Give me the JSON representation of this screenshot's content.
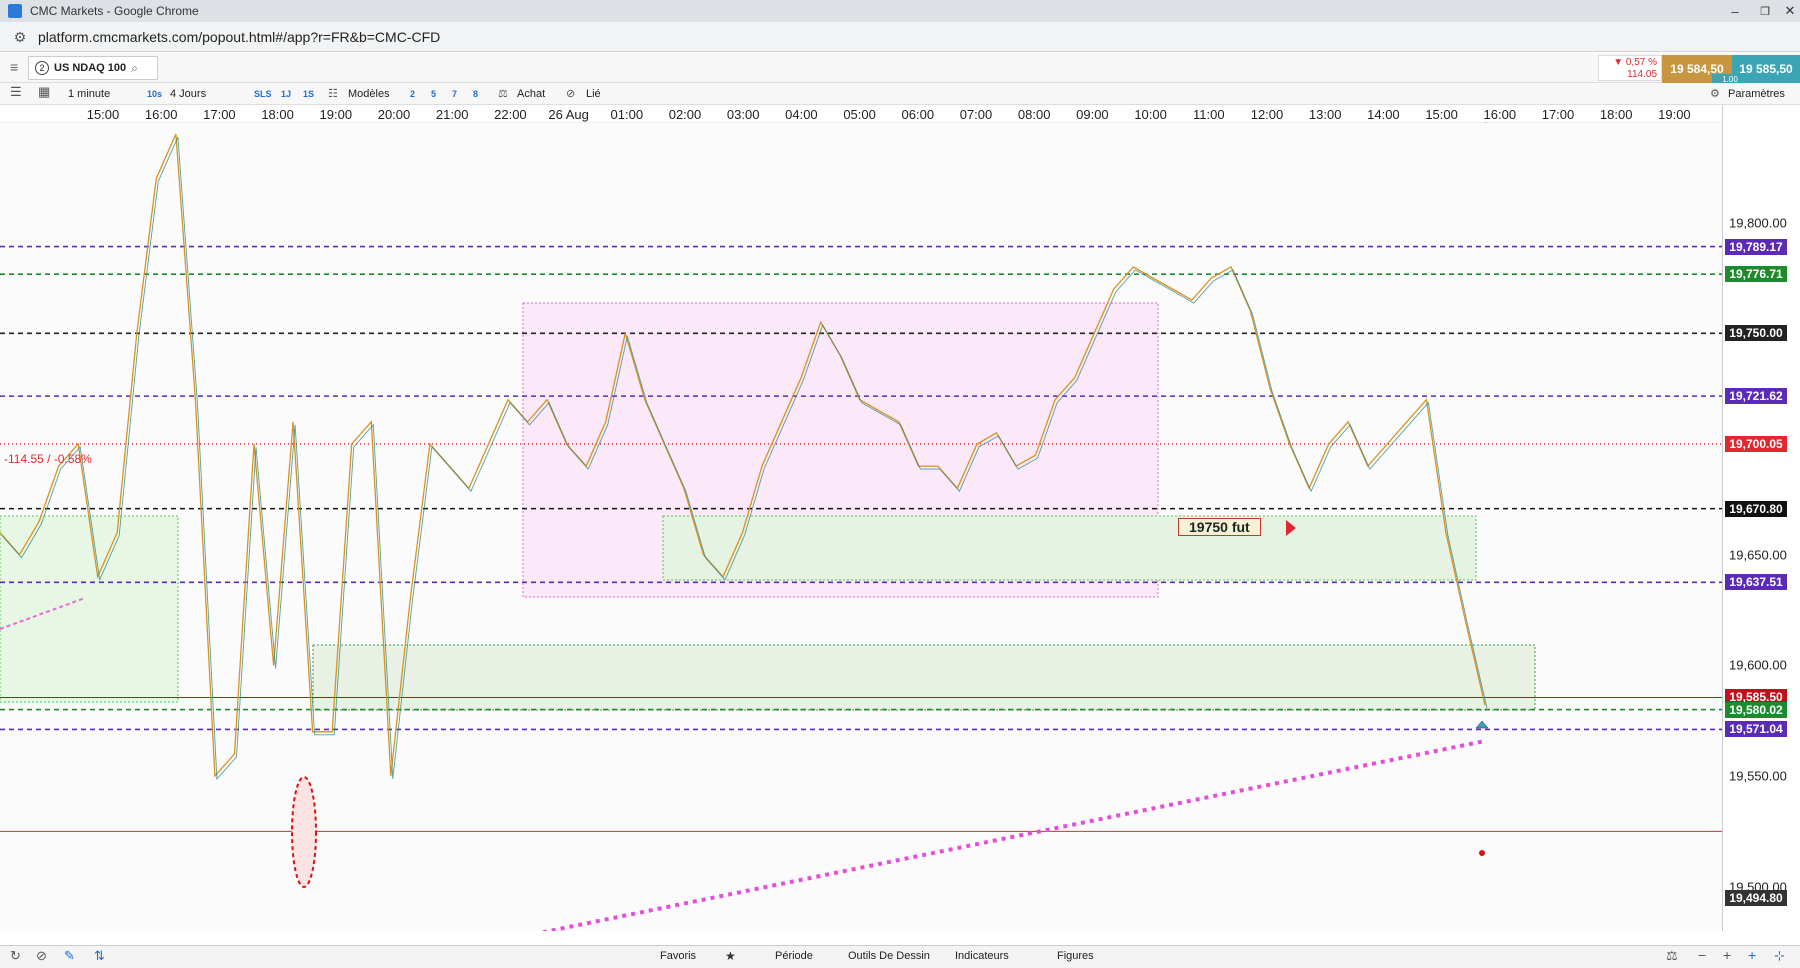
{
  "window": {
    "title": "CMC Markets - Google Chrome",
    "url": "platform.cmcmarkets.com/popout.html#/app?r=FR&b=CMC-CFD",
    "minimize": "–",
    "restore": "❐",
    "close": "✕"
  },
  "instrument": {
    "number": "2",
    "name": "US NDAQ 100"
  },
  "quote": {
    "change_pct": "▼ 0,57 %",
    "change_pts": "114.05",
    "sell": "19 584,50",
    "buy": "19 585,50",
    "spread": "1.00",
    "sell_color": "#c8963e",
    "buy_color": "#3aa5b5"
  },
  "toolbar": {
    "interval": "1 minute",
    "tf_10s": "10s",
    "range": "4 Jours",
    "tf_sls": "SLS",
    "tf_1j": "1J",
    "tf_1s": "1S",
    "models": "Modèles",
    "n2": "2",
    "n5": "5",
    "n7": "7",
    "n8": "8",
    "buy": "Achat",
    "linked": "Lié",
    "settings": "Paramètres"
  },
  "time_axis": [
    "15:00",
    "16:00",
    "17:00",
    "18:00",
    "19:00",
    "20:00",
    "21:00",
    "22:00",
    "26 Aug",
    "01:00",
    "02:00",
    "03:00",
    "04:00",
    "05:00",
    "06:00",
    "07:00",
    "08:00",
    "09:00",
    "10:00",
    "11:00",
    "12:00",
    "13:00",
    "14:00",
    "15:00",
    "16:00",
    "17:00",
    "18:00",
    "19:00"
  ],
  "price_axis": {
    "ticks": [
      "19,800.00",
      "19,750.00",
      "19,650.00",
      "19,600.00",
      "19,550.00",
      "19,500.00"
    ],
    "tags": [
      {
        "label": "19,789.17",
        "color": "#5b2bb5"
      },
      {
        "label": "19,776.71",
        "color": "#1e8a2e"
      },
      {
        "label": "19,750.00",
        "color": "#222222"
      },
      {
        "label": "19,721.62",
        "color": "#5b2bb5"
      },
      {
        "label": "19,700.05",
        "color": "#e0282e"
      },
      {
        "label": "19,670.80",
        "color": "#111111"
      },
      {
        "label": "19,637.51",
        "color": "#5b2bb5"
      },
      {
        "label": "19,585.50",
        "color": "#c0101a"
      },
      {
        "label": "19,580.02",
        "color": "#1e8a2e"
      },
      {
        "label": "19,571.04",
        "color": "#5b2bb5"
      },
      {
        "label": "19,494.80",
        "color": "#333333"
      }
    ]
  },
  "annotations": {
    "fut_label": "19750  fut",
    "change_label": "-114.55 / -0.58%"
  },
  "bottom_tabs": {
    "favoris": "Favoris",
    "periode": "Période",
    "outils": "Outils De Dessin",
    "indicateurs": "Indicateurs",
    "figures": "Figures"
  },
  "chart_data": {
    "type": "line",
    "title": "",
    "xlabel": "",
    "ylabel": "",
    "ylim": [
      19480,
      19845
    ],
    "x_start": "15:00",
    "x_end": "16:00 (26 Aug)",
    "series": [
      {
        "values": [
          19660,
          19650,
          19665,
          19690,
          19700,
          19640,
          19660,
          19750,
          19820,
          19840,
          19720,
          19550,
          19560,
          19700,
          19600,
          19710,
          19570,
          19570,
          19700,
          19710,
          19550,
          19630,
          19700,
          19690,
          19680,
          19700,
          19720,
          19710,
          19720,
          19700,
          19690,
          19710,
          19750,
          19720,
          19700,
          19680,
          19650,
          19640,
          19660,
          19690,
          19710,
          19730,
          19755,
          19740,
          19720,
          19715,
          19710,
          19690,
          19690,
          19680,
          19700,
          19705,
          19690,
          19695,
          19720,
          19730,
          19750,
          19770,
          19780,
          19775,
          19770,
          19765,
          19775,
          19780,
          19760,
          19725,
          19700,
          19680,
          19700,
          19710,
          19690,
          19700,
          19710,
          19720,
          19660,
          19620,
          19582
        ]
      }
    ],
    "horizontal_levels": [
      19789.17,
      19776.71,
      19750.0,
      19721.62,
      19700.05,
      19670.8,
      19637.51,
      19585.5,
      19580.02,
      19571.04,
      19525.0
    ],
    "grid": false,
    "legend": "none"
  }
}
